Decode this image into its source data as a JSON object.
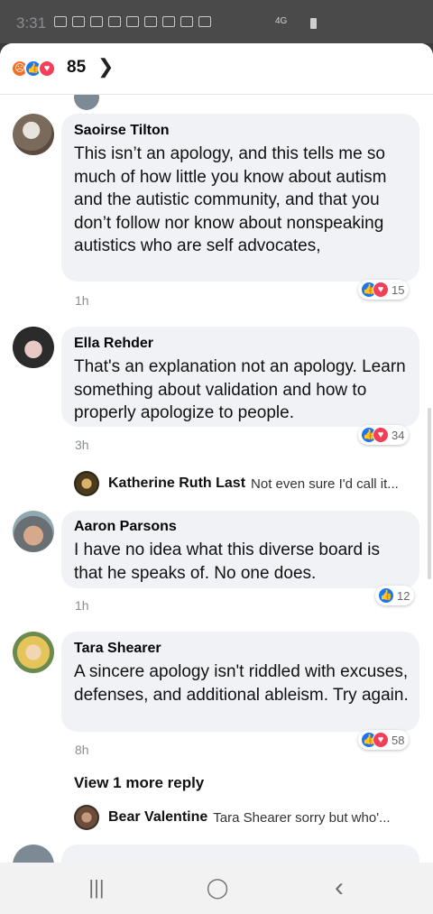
{
  "status_bar": {
    "time": "3:31",
    "network": "4G"
  },
  "reactions_header": {
    "total": "85",
    "types": [
      "angry-icon",
      "like-icon",
      "love-icon"
    ]
  },
  "comments": [
    {
      "name": "Saoirse Tilton",
      "text": "This isn’t an apology, and this tells me so much of how little you know about autism and the autistic community, and that you don’t follow nor know about nonspeaking autistics who are self advocates,",
      "time": "1h",
      "reactions": "15"
    },
    {
      "name": "Ella Rehder",
      "text": "That's an explanation not an apology. Learn something about validation and how to properly apologize to people.",
      "time": "3h",
      "reactions": "34",
      "reply": {
        "name": "Katherine Ruth Last",
        "text": "Not even sure I'd call it..."
      }
    },
    {
      "name": "Aaron Parsons",
      "text": "I have no idea what this diverse board is that he speaks of. No one does.",
      "time": "1h",
      "reactions": "12"
    },
    {
      "name": "Tara Shearer",
      "text": "A sincere apology isn't riddled with excuses, defenses, and additional ableism.  Try again.",
      "time": "8h",
      "reactions": "58",
      "view_more": "View 1 more reply",
      "reply": {
        "name": "Bear Valentine",
        "text": "Tara Shearer sorry but who'..."
      }
    }
  ],
  "colors": {
    "like": "#1877f2",
    "love": "#f33e58",
    "angry": "#f0712c",
    "bubble": "#f0f2f5"
  },
  "nav": {
    "recents": "|||",
    "home": "◯",
    "back": "‹"
  }
}
